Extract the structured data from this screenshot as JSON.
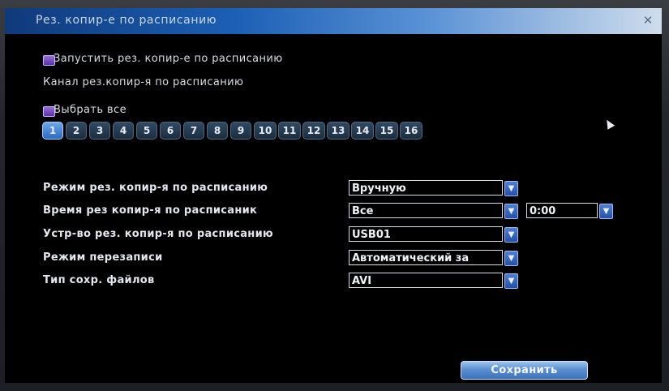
{
  "window": {
    "title": "Рез. копир-е по расписанию"
  },
  "schedule": {
    "enable_label": "Запустить рез. копир-е по расписанию",
    "channel_label": "Канал рез.копир-я по расписанию",
    "select_all_label": "Выбрать все",
    "channels": [
      "1",
      "2",
      "3",
      "4",
      "5",
      "6",
      "7",
      "8",
      "9",
      "10",
      "11",
      "12",
      "13",
      "14",
      "15",
      "16"
    ],
    "selected_channel": "1"
  },
  "settings": {
    "mode": {
      "label": "Режим рез. копир-я по расписанию",
      "value": "Вручную"
    },
    "time": {
      "label": "Время рез копир-я по расписаник",
      "value": "Все",
      "time_value": "0:00"
    },
    "device": {
      "label": "Устр-во рез. копир-я по расписанию",
      "value": "USB01"
    },
    "overwrite": {
      "label": "Режим перезаписи",
      "value": "Автоматический за"
    },
    "file_type": {
      "label": "Тип сохр. файлов",
      "value": "AVI"
    }
  },
  "actions": {
    "save_label": "Сохранить"
  },
  "colors": {
    "title_bar_start": "#0f3a7a",
    "accent": "#2a6bc2",
    "checkbox": "#5a2fb0",
    "background": "#000000"
  },
  "icons": {
    "close": "close-icon",
    "dropdown": "chevron-down-icon",
    "cursor": "cursor-icon"
  }
}
